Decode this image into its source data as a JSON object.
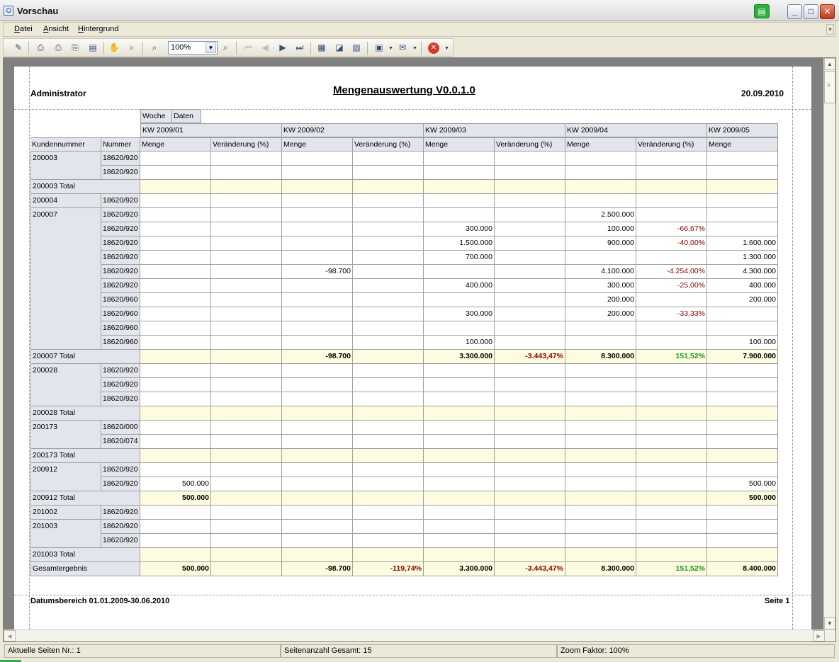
{
  "window": {
    "title": "Vorschau"
  },
  "menu": {
    "items": [
      "Datei",
      "Ansicht",
      "Hintergrund"
    ]
  },
  "toolbar": {
    "zoom_value": "100%",
    "icons": [
      "edit-icon",
      "page-setup-icon",
      "print-icon",
      "export-icon",
      "page-view-icon",
      "hand-icon",
      "magnifier-icon",
      "zoom-out-icon",
      "zoom-in-icon",
      "first-page-icon",
      "prev-page-icon",
      "next-page-icon",
      "last-page-icon",
      "layout-icon",
      "background-icon",
      "watermark-icon",
      "save-icon",
      "email-icon",
      "close-icon"
    ]
  },
  "report": {
    "user": "Administrator",
    "title": "Mengenauswertung V0.0.1.0",
    "date": "20.09.2010",
    "footer_left": "Datumsbereich 01.01.2009-30.06.2010",
    "footer_right": "Seite 1"
  },
  "pivot": {
    "filter_fields": [
      "Woche",
      "Daten"
    ],
    "weeks": [
      "KW 2009/01",
      "KW 2009/02",
      "KW 2009/03",
      "KW 2009/04",
      "KW 2009/05"
    ],
    "row_headers": [
      "Kundennummer",
      "Nummer"
    ],
    "measure_menge": "Menge",
    "measure_change": "Veränderung (%)",
    "rows": [
      {
        "k": "200003",
        "n": "18620/920",
        "v": [
          "",
          "",
          "",
          "",
          "",
          "",
          "",
          "",
          ""
        ]
      },
      {
        "k": "",
        "n": "18620/920",
        "v": [
          "",
          "",
          "",
          "",
          "",
          "",
          "",
          "",
          ""
        ]
      },
      {
        "total": "200003 Total",
        "v": [
          "",
          "",
          "",
          "",
          "",
          "",
          "",
          "",
          ""
        ]
      },
      {
        "k": "200004",
        "n": "18620/920",
        "v": [
          "",
          "",
          "",
          "",
          "",
          "",
          "",
          "",
          ""
        ]
      },
      {
        "k": "200007",
        "n": "18620/920",
        "v": [
          "",
          "",
          "",
          "",
          "",
          "",
          "2.500.000",
          "",
          ""
        ]
      },
      {
        "k": "",
        "n": "18620/920",
        "v": [
          "",
          "",
          "",
          "",
          "300.000",
          "",
          "100.000",
          "-66,67%",
          ""
        ]
      },
      {
        "k": "",
        "n": "18620/920",
        "v": [
          "",
          "",
          "",
          "",
          "1.500.000",
          "",
          "900.000",
          "-40,00%",
          "1.600.000"
        ]
      },
      {
        "k": "",
        "n": "18620/920",
        "v": [
          "",
          "",
          "",
          "",
          "700.000",
          "",
          "",
          "",
          "1.300.000"
        ]
      },
      {
        "k": "",
        "n": "18620/920",
        "v": [
          "",
          "",
          "-98.700",
          "",
          "",
          "",
          "4.100.000",
          "-4.254,00%",
          "4.300.000"
        ]
      },
      {
        "k": "",
        "n": "18620/920",
        "v": [
          "",
          "",
          "",
          "",
          "400.000",
          "",
          "300.000",
          "-25,00%",
          "400.000"
        ]
      },
      {
        "k": "",
        "n": "18620/960",
        "v": [
          "",
          "",
          "",
          "",
          "",
          "",
          "200.000",
          "",
          "200.000"
        ]
      },
      {
        "k": "",
        "n": "18620/960",
        "v": [
          "",
          "",
          "",
          "",
          "300.000",
          "",
          "200.000",
          "-33,33%",
          ""
        ]
      },
      {
        "k": "",
        "n": "18620/960",
        "v": [
          "",
          "",
          "",
          "",
          "",
          "",
          "",
          "",
          ""
        ]
      },
      {
        "k": "",
        "n": "18620/960",
        "v": [
          "",
          "",
          "",
          "",
          "100.000",
          "",
          "",
          "",
          "100.000"
        ]
      },
      {
        "total": "200007 Total",
        "v": [
          "",
          "",
          "-98.700",
          "",
          "3.300.000",
          "-3.443,47%",
          "8.300.000",
          "151,52%",
          "7.900.000"
        ]
      },
      {
        "k": "200028",
        "n": "18620/920",
        "v": [
          "",
          "",
          "",
          "",
          "",
          "",
          "",
          "",
          ""
        ]
      },
      {
        "k": "",
        "n": "18620/920",
        "v": [
          "",
          "",
          "",
          "",
          "",
          "",
          "",
          "",
          ""
        ]
      },
      {
        "k": "",
        "n": "18620/920",
        "v": [
          "",
          "",
          "",
          "",
          "",
          "",
          "",
          "",
          ""
        ]
      },
      {
        "total": "200028 Total",
        "v": [
          "",
          "",
          "",
          "",
          "",
          "",
          "",
          "",
          ""
        ]
      },
      {
        "k": "200173",
        "n": "18620/000",
        "v": [
          "",
          "",
          "",
          "",
          "",
          "",
          "",
          "",
          ""
        ]
      },
      {
        "k": "",
        "n": "18620/074",
        "v": [
          "",
          "",
          "",
          "",
          "",
          "",
          "",
          "",
          ""
        ]
      },
      {
        "total": "200173 Total",
        "v": [
          "",
          "",
          "",
          "",
          "",
          "",
          "",
          "",
          ""
        ]
      },
      {
        "k": "200912",
        "n": "18620/920",
        "v": [
          "",
          "",
          "",
          "",
          "",
          "",
          "",
          "",
          ""
        ]
      },
      {
        "k": "",
        "n": "18620/920",
        "v": [
          "500.000",
          "",
          "",
          "",
          "",
          "",
          "",
          "",
          "500.000"
        ]
      },
      {
        "total": "200912 Total",
        "v": [
          "500.000",
          "",
          "",
          "",
          "",
          "",
          "",
          "",
          "500.000"
        ]
      },
      {
        "k": "201002",
        "n": "18620/920",
        "v": [
          "",
          "",
          "",
          "",
          "",
          "",
          "",
          "",
          ""
        ]
      },
      {
        "k": "201003",
        "n": "18620/920",
        "v": [
          "",
          "",
          "",
          "",
          "",
          "",
          "",
          "",
          ""
        ]
      },
      {
        "k": "",
        "n": "18620/920",
        "v": [
          "",
          "",
          "",
          "",
          "",
          "",
          "",
          "",
          ""
        ]
      },
      {
        "total": "201003 Total",
        "v": [
          "",
          "",
          "",
          "",
          "",
          "",
          "",
          "",
          ""
        ]
      },
      {
        "grand": "Gesamtergebnis",
        "v": [
          "500.000",
          "",
          "-98.700",
          "-119,74%",
          "3.300.000",
          "-3.443,47%",
          "8.300.000",
          "151,52%",
          "8.400.000"
        ]
      }
    ]
  },
  "status": {
    "current_page": "Aktuelle Seiten Nr.: 1",
    "page_count": "Seitenanzahl Gesamt: 15",
    "zoom": "Zoom Faktor: 100%"
  },
  "colors": {
    "negative": "#8b0000",
    "positive": "#1e9a1e",
    "total_row": "#fdfbe0",
    "header": "#e3e5ec"
  }
}
